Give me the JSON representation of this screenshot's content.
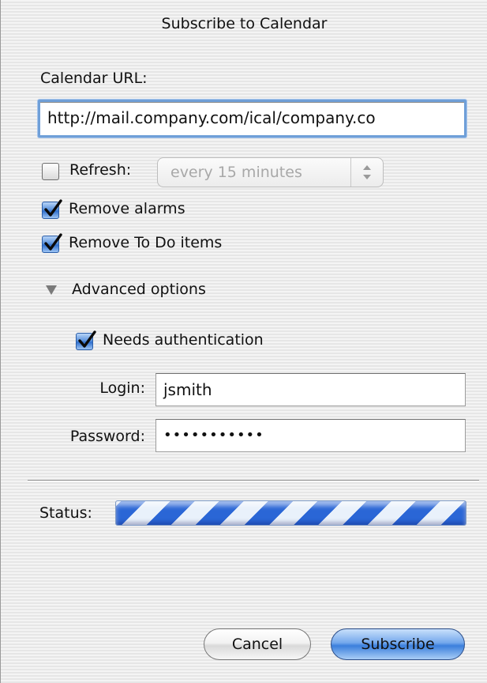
{
  "window": {
    "title": "Subscribe to Calendar"
  },
  "url": {
    "label": "Calendar URL:",
    "value": "http://mail.company.com/ical/company.co"
  },
  "refresh": {
    "label": "Refresh:",
    "checked": false,
    "interval": "every 15 minutes",
    "enabled": false
  },
  "remove_alarms": {
    "label": "Remove alarms",
    "checked": true
  },
  "remove_todo": {
    "label": "Remove To Do items",
    "checked": true
  },
  "advanced": {
    "label": "Advanced options",
    "expanded": true
  },
  "auth": {
    "label": "Needs authentication",
    "checked": true,
    "login_label": "Login:",
    "login_value": "jsmith",
    "password_label": "Password:",
    "password_value": "•••••••••••"
  },
  "status": {
    "label": "Status:",
    "indeterminate": true
  },
  "buttons": {
    "cancel": "Cancel",
    "subscribe": "Subscribe"
  },
  "colors": {
    "accent": "#3b7fdc",
    "focus_ring": "#6f9fd8",
    "progress_stripe": "#2a66d6"
  },
  "icons": {
    "checkmark": "checkmark-icon",
    "disclosure": "disclosure-triangle-icon",
    "stepper": "up-down-arrows-icon"
  }
}
